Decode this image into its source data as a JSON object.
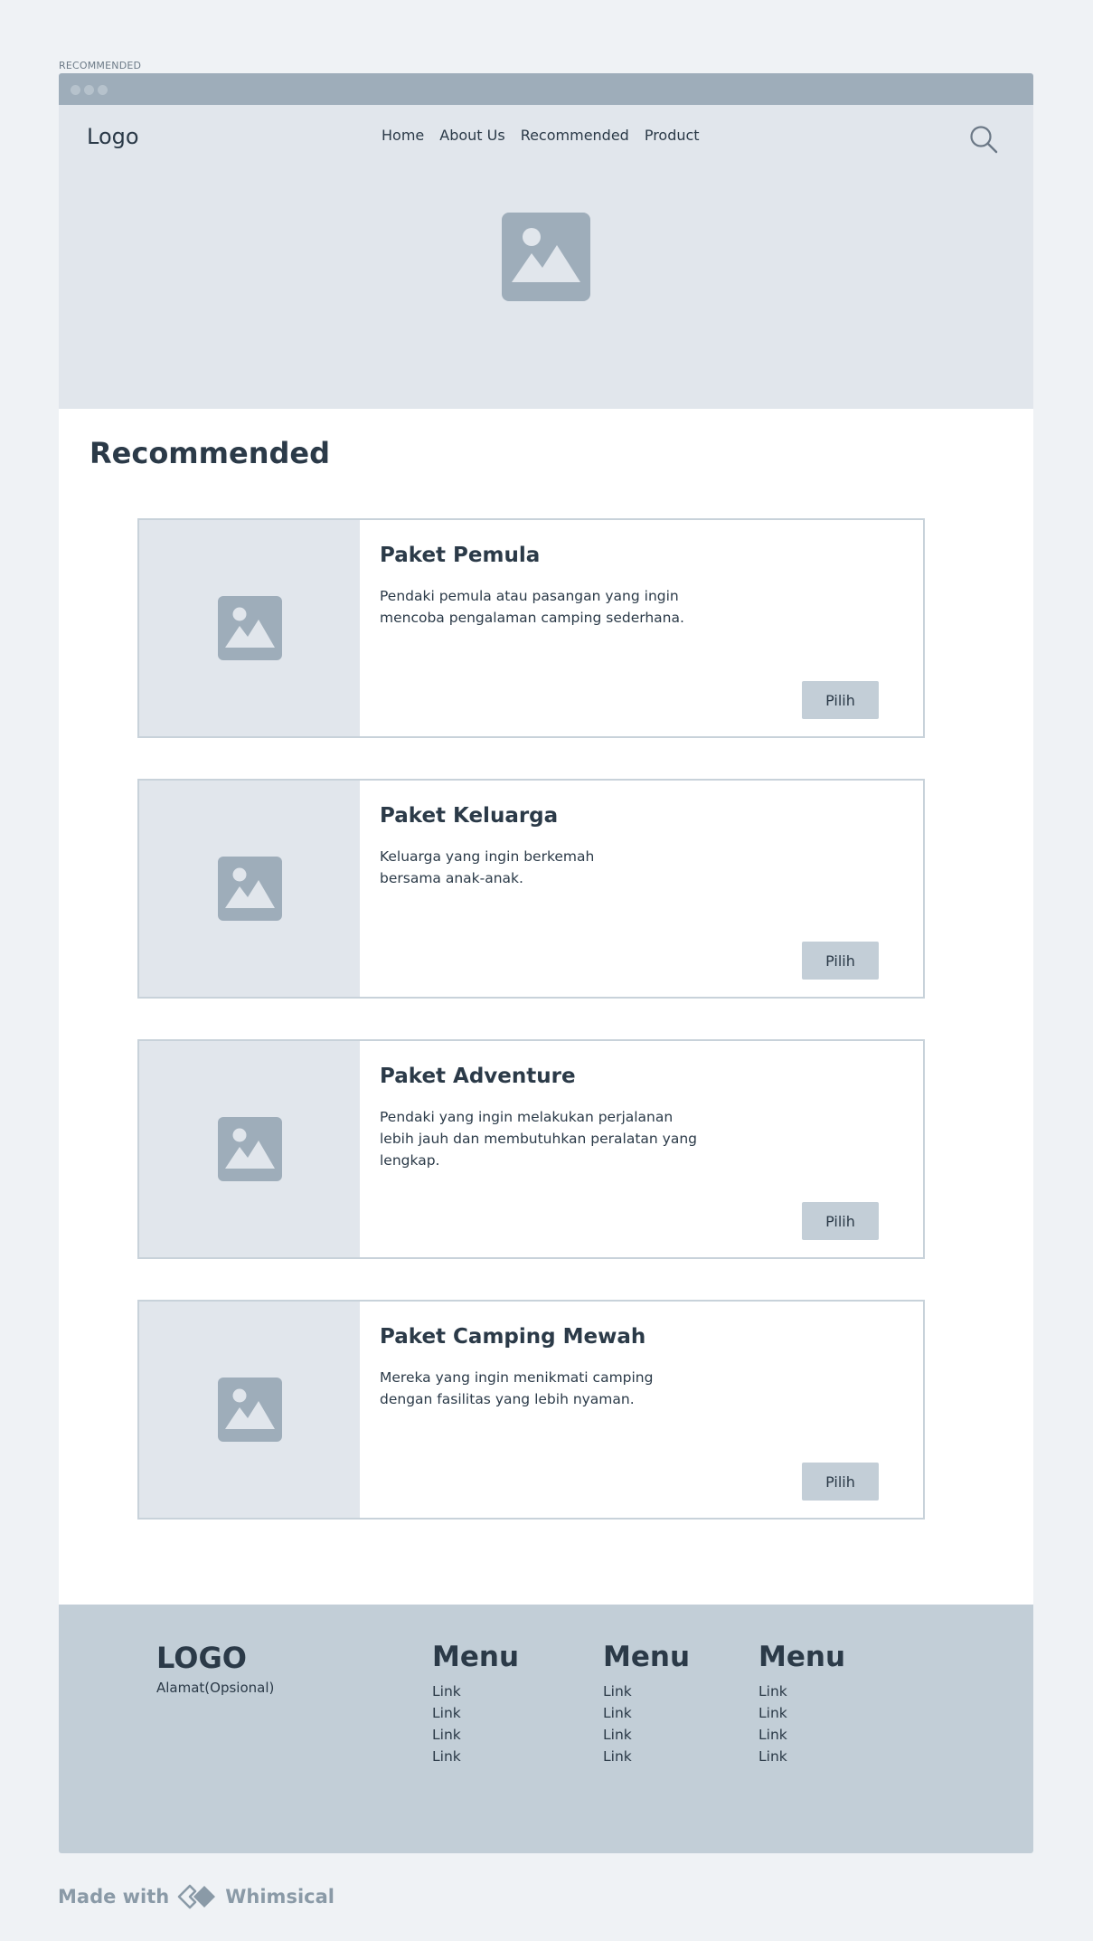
{
  "frame_label": "RECOMMENDED",
  "header": {
    "logo": "Logo",
    "nav": [
      "Home",
      "About Us",
      "Recommended",
      "Product"
    ],
    "search_icon": "search-icon"
  },
  "hero": {
    "image_icon": "image-placeholder-icon"
  },
  "recommended": {
    "title": "Recommended",
    "cards": [
      {
        "title": "Paket Pemula",
        "description": "Pendaki pemula atau pasangan yang ingin mencoba pengalaman camping sederhana.",
        "button": "Pilih"
      },
      {
        "title": "Paket Keluarga",
        "description": "Keluarga yang ingin berkemah bersama anak-anak.",
        "button": "Pilih"
      },
      {
        "title": "Paket Adventure",
        "description": "Pendaki yang ingin melakukan perjalanan lebih jauh dan membutuhkan peralatan yang lengkap.",
        "button": "Pilih"
      },
      {
        "title": "Paket Camping Mewah",
        "description": "Mereka yang ingin menikmati camping dengan fasilitas yang lebih nyaman.",
        "button": "Pilih"
      }
    ]
  },
  "footer": {
    "logo": "LOGO",
    "address": "Alamat(Opsional)",
    "columns": [
      {
        "title": "Menu",
        "links": [
          "Link",
          "Link",
          "Link",
          "Link"
        ]
      },
      {
        "title": "Menu",
        "links": [
          "Link",
          "Link",
          "Link",
          "Link"
        ]
      },
      {
        "title": "Menu",
        "links": [
          "Link",
          "Link",
          "Link",
          "Link"
        ]
      }
    ]
  },
  "branding": {
    "made_with": "Made with",
    "brand": "Whimsical"
  },
  "colors": {
    "background": "#eff2f5",
    "chrome": "#9eadba",
    "hero": "#e1e6ec",
    "footer": "#c2ced7",
    "button": "#c3ced7",
    "text": "#2b3a48",
    "placeholder": "#9eadba"
  }
}
